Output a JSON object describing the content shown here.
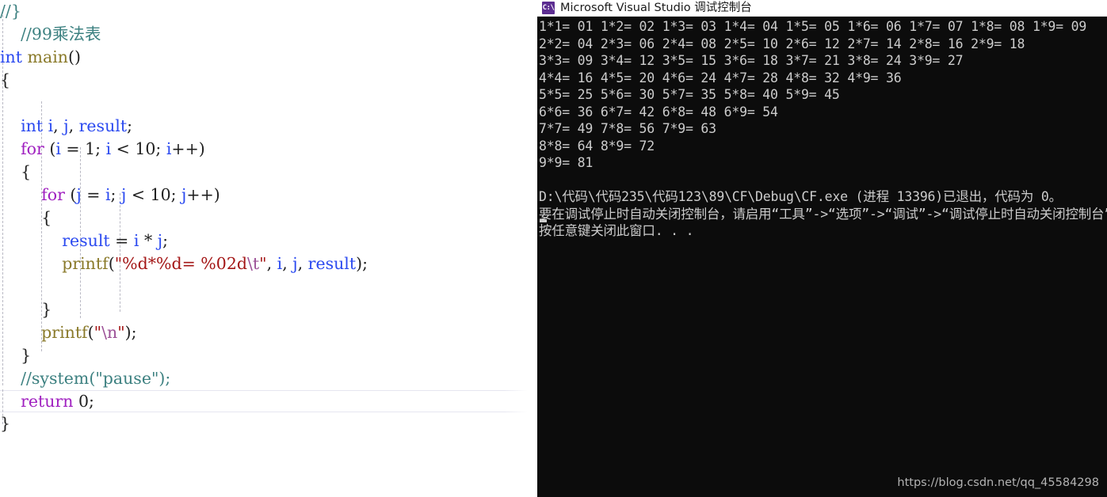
{
  "editor": {
    "name": "visual-studio-code-editor",
    "font_size_px": 20.5,
    "current_line_index": 14,
    "colors": {
      "comment": "#3c8080",
      "type": "#2b4af0",
      "keyword": "#a020c0",
      "function": "#8a7a2a",
      "string": "#a31515",
      "escape": "#9b4f96",
      "plain": "#1f1f1f",
      "background": "#ffffff",
      "indent_guide": "#b9b9c4",
      "current_line_border": "#e6e6f0"
    },
    "lines": [
      {
        "indent": 0,
        "tokens": [
          {
            "t": "//}",
            "c": "comment"
          }
        ]
      },
      {
        "indent": 0,
        "tokens": [
          {
            "t": "    ",
            "c": "plain"
          },
          {
            "t": "//99乘法表",
            "c": "comment"
          }
        ]
      },
      {
        "indent": 0,
        "tokens": [
          {
            "t": "int",
            "c": "type"
          },
          {
            "t": " ",
            "c": "plain"
          },
          {
            "t": "main",
            "c": "func"
          },
          {
            "t": "()",
            "c": "plain"
          }
        ]
      },
      {
        "indent": 0,
        "tokens": [
          {
            "t": "{",
            "c": "plain"
          }
        ]
      },
      {
        "indent": 0,
        "tokens": [
          {
            "t": "",
            "c": "plain"
          }
        ]
      },
      {
        "indent": 0,
        "tokens": [
          {
            "t": "    ",
            "c": "plain"
          },
          {
            "t": "int",
            "c": "type"
          },
          {
            "t": " ",
            "c": "plain"
          },
          {
            "t": "i",
            "c": "type"
          },
          {
            "t": ", ",
            "c": "plain"
          },
          {
            "t": "j",
            "c": "type"
          },
          {
            "t": ", ",
            "c": "plain"
          },
          {
            "t": "result",
            "c": "type"
          },
          {
            "t": ";",
            "c": "plain"
          }
        ]
      },
      {
        "indent": 0,
        "tokens": [
          {
            "t": "    ",
            "c": "plain"
          },
          {
            "t": "for",
            "c": "keyword"
          },
          {
            "t": " (",
            "c": "plain"
          },
          {
            "t": "i",
            "c": "type"
          },
          {
            "t": " = 1; ",
            "c": "plain"
          },
          {
            "t": "i",
            "c": "type"
          },
          {
            "t": " < 10; ",
            "c": "plain"
          },
          {
            "t": "i",
            "c": "type"
          },
          {
            "t": "++)",
            "c": "plain"
          }
        ]
      },
      {
        "indent": 0,
        "tokens": [
          {
            "t": "    {",
            "c": "plain"
          }
        ]
      },
      {
        "indent": 0,
        "tokens": [
          {
            "t": "        ",
            "c": "plain"
          },
          {
            "t": "for",
            "c": "keyword"
          },
          {
            "t": " (",
            "c": "plain"
          },
          {
            "t": "j",
            "c": "type"
          },
          {
            "t": " = ",
            "c": "plain"
          },
          {
            "t": "i",
            "c": "type"
          },
          {
            "t": "; ",
            "c": "plain"
          },
          {
            "t": "j",
            "c": "type"
          },
          {
            "t": " < 10; ",
            "c": "plain"
          },
          {
            "t": "j",
            "c": "type"
          },
          {
            "t": "++)",
            "c": "plain"
          }
        ]
      },
      {
        "indent": 0,
        "tokens": [
          {
            "t": "        {",
            "c": "plain"
          }
        ]
      },
      {
        "indent": 0,
        "tokens": [
          {
            "t": "            ",
            "c": "plain"
          },
          {
            "t": "result",
            "c": "type"
          },
          {
            "t": " = ",
            "c": "plain"
          },
          {
            "t": "i",
            "c": "type"
          },
          {
            "t": " * ",
            "c": "plain"
          },
          {
            "t": "j",
            "c": "type"
          },
          {
            "t": ";",
            "c": "plain"
          }
        ]
      },
      {
        "indent": 0,
        "tokens": [
          {
            "t": "            ",
            "c": "plain"
          },
          {
            "t": "printf",
            "c": "func"
          },
          {
            "t": "(",
            "c": "plain"
          },
          {
            "t": "\"%d*%d= %02d",
            "c": "string"
          },
          {
            "t": "\\t",
            "c": "escape"
          },
          {
            "t": "\"",
            "c": "string"
          },
          {
            "t": ", ",
            "c": "plain"
          },
          {
            "t": "i",
            "c": "type"
          },
          {
            "t": ", ",
            "c": "plain"
          },
          {
            "t": "j",
            "c": "type"
          },
          {
            "t": ", ",
            "c": "plain"
          },
          {
            "t": "result",
            "c": "type"
          },
          {
            "t": ");",
            "c": "plain"
          }
        ]
      },
      {
        "indent": 0,
        "tokens": [
          {
            "t": "",
            "c": "plain"
          }
        ]
      },
      {
        "indent": 0,
        "tokens": [
          {
            "t": "        }",
            "c": "plain"
          }
        ]
      },
      {
        "indent": 0,
        "tokens": [
          {
            "t": "        ",
            "c": "plain"
          },
          {
            "t": "printf",
            "c": "func"
          },
          {
            "t": "(",
            "c": "plain"
          },
          {
            "t": "\"",
            "c": "string"
          },
          {
            "t": "\\n",
            "c": "escape"
          },
          {
            "t": "\"",
            "c": "string"
          },
          {
            "t": ");",
            "c": "plain"
          }
        ]
      },
      {
        "indent": 0,
        "tokens": [
          {
            "t": "    }",
            "c": "plain"
          }
        ]
      },
      {
        "indent": 0,
        "tokens": [
          {
            "t": "    ",
            "c": "plain"
          },
          {
            "t": "//system(\"pause\");",
            "c": "comment"
          }
        ]
      },
      {
        "indent": 0,
        "current": true,
        "tokens": [
          {
            "t": "    ",
            "c": "plain"
          },
          {
            "t": "return",
            "c": "keyword"
          },
          {
            "t": " 0;",
            "c": "plain"
          }
        ]
      },
      {
        "indent": 0,
        "tokens": [
          {
            "t": "}",
            "c": "plain"
          }
        ]
      }
    ]
  },
  "console": {
    "name": "visual-studio-debug-console",
    "icon": "console-window-icon",
    "icon_text": "C:\\",
    "title": "Microsoft Visual Studio 调试控制台",
    "background": "#0c0c0c",
    "text_color": "#cccccc",
    "output_lines": [
      "1*1= 01 1*2= 02 1*3= 03 1*4= 04 1*5= 05 1*6= 06 1*7= 07 1*8= 08 1*9= 09",
      "2*2= 04 2*3= 06 2*4= 08 2*5= 10 2*6= 12 2*7= 14 2*8= 16 2*9= 18",
      "3*3= 09 3*4= 12 3*5= 15 3*6= 18 3*7= 21 3*8= 24 3*9= 27",
      "4*4= 16 4*5= 20 4*6= 24 4*7= 28 4*8= 32 4*9= 36",
      "5*5= 25 5*6= 30 5*7= 35 5*8= 40 5*9= 45",
      "6*6= 36 6*7= 42 6*8= 48 6*9= 54",
      "7*7= 49 7*8= 56 7*9= 63",
      "8*8= 64 8*9= 72",
      "9*9= 81",
      "",
      "D:\\代码\\代码235\\代码123\\89\\CF\\Debug\\CF.exe (进程 13396)已退出，代码为 0。",
      "要在调试停止时自动关闭控制台，请启用“工具”->“选项”->“调试”->“调试停止时自动关闭控制台”。",
      "按任意键关闭此窗口. . ."
    ],
    "exit_path": "D:\\代码\\代码235\\代码123\\89\\CF\\Debug\\CF.exe",
    "process_id": "13396",
    "exit_code": "0"
  },
  "watermark": {
    "text": "https://blog.csdn.net/qq_45584298"
  }
}
